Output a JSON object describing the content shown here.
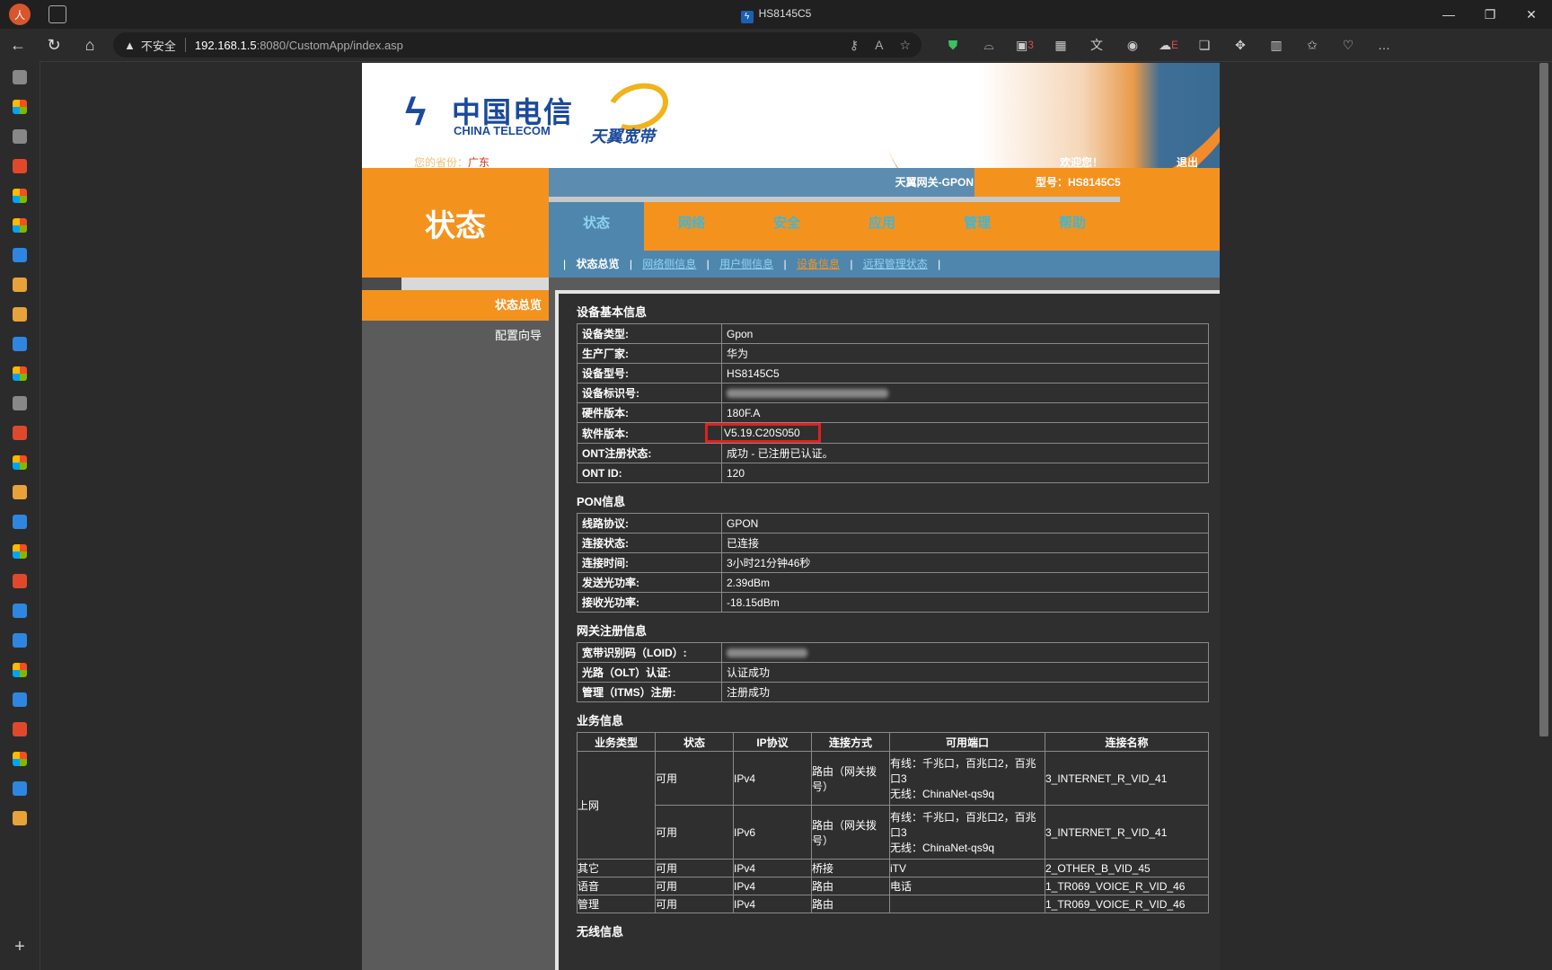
{
  "browser": {
    "window_title": "HS8145C5",
    "profile_initial": "人",
    "security_label": "不安全",
    "url_host": "192.168.1.5",
    "url_path": ":8080/CustomApp/index.asp",
    "badge_count": "3",
    "badge_e": "E"
  },
  "header": {
    "brand_cn": "中国电信",
    "brand_en": "CHINA TELECOM",
    "sub_brand": "天翼宽带",
    "location_label": "您的省份：",
    "location_value": "广东",
    "welcome": "欢迎您！",
    "logout": "退出",
    "section_title": "状态",
    "gateway_name": "天翼网关-GPON",
    "model": "型号：HS8145C5"
  },
  "menu": {
    "items": [
      {
        "label": "状态"
      },
      {
        "label": "网络"
      },
      {
        "label": "安全"
      },
      {
        "label": "应用"
      },
      {
        "label": "管理"
      },
      {
        "label": "帮助"
      }
    ]
  },
  "submenu": {
    "sep": "|",
    "items": [
      {
        "label": "状态总览"
      },
      {
        "label": "网络侧信息"
      },
      {
        "label": "用户侧信息"
      },
      {
        "label": "设备信息"
      },
      {
        "label": "远程管理状态"
      }
    ]
  },
  "leftmenu": {
    "items": [
      {
        "label": "状态总览"
      },
      {
        "label": "配置向导"
      }
    ]
  },
  "device": {
    "title": "设备基本信息",
    "rows": [
      {
        "k": "设备类型:",
        "v": "Gpon"
      },
      {
        "k": "生产厂家:",
        "v": "华为"
      },
      {
        "k": "设备型号:",
        "v": "HS8145C5"
      },
      {
        "k": "设备标识号:",
        "v": ""
      },
      {
        "k": "硬件版本:",
        "v": "180F.A"
      },
      {
        "k": "软件版本:",
        "v": "V5.19.C20S050"
      },
      {
        "k": "ONT注册状态:",
        "v": "成功 - 已注册已认证。"
      },
      {
        "k": "ONT ID:",
        "v": "120"
      }
    ]
  },
  "pon": {
    "title": "PON信息",
    "rows": [
      {
        "k": "线路协议:",
        "v": "GPON"
      },
      {
        "k": "连接状态:",
        "v": "已连接"
      },
      {
        "k": "连接时间:",
        "v": "3小时21分钟46秒"
      },
      {
        "k": "发送光功率:",
        "v": "2.39dBm"
      },
      {
        "k": "接收光功率:",
        "v": "-18.15dBm"
      }
    ]
  },
  "gateway": {
    "title": "网关注册信息",
    "rows": [
      {
        "k": "宽带识别码（LOID）:",
        "v": ""
      },
      {
        "k": "光路（OLT）认证:",
        "v": "认证成功"
      },
      {
        "k": "管理（ITMS）注册:",
        "v": "注册成功"
      }
    ]
  },
  "service": {
    "title": "业务信息",
    "headers": [
      "业务类型",
      "状态",
      "IP协议",
      "连接方式",
      "可用端口",
      "连接名称"
    ],
    "internet_label": "上网",
    "rows": [
      {
        "status": "可用",
        "ip": "IPv4",
        "mode": "路由（网关拨号）",
        "port1": "有线：千兆口，百兆口2，百兆口3",
        "port2": "无线：ChinaNet-qs9q",
        "name": "3_INTERNET_R_VID_41"
      },
      {
        "status": "可用",
        "ip": "IPv6",
        "mode": "路由（网关拨号）",
        "port1": "有线：千兆口，百兆口2，百兆口3",
        "port2": "无线：ChinaNet-qs9q",
        "name": "3_INTERNET_R_VID_41"
      }
    ],
    "others": [
      {
        "type": "其它",
        "status": "可用",
        "ip": "IPv4",
        "mode": "桥接",
        "port": "iTV",
        "name": "2_OTHER_B_VID_45"
      },
      {
        "type": "语音",
        "status": "可用",
        "ip": "IPv4",
        "mode": "路由",
        "port": "电话",
        "name": "1_TR069_VOICE_R_VID_46"
      },
      {
        "type": "管理",
        "status": "可用",
        "ip": "IPv4",
        "mode": "路由",
        "port": "",
        "name": "1_TR069_VOICE_R_VID_46"
      }
    ]
  },
  "wireless_title": "无线信息"
}
